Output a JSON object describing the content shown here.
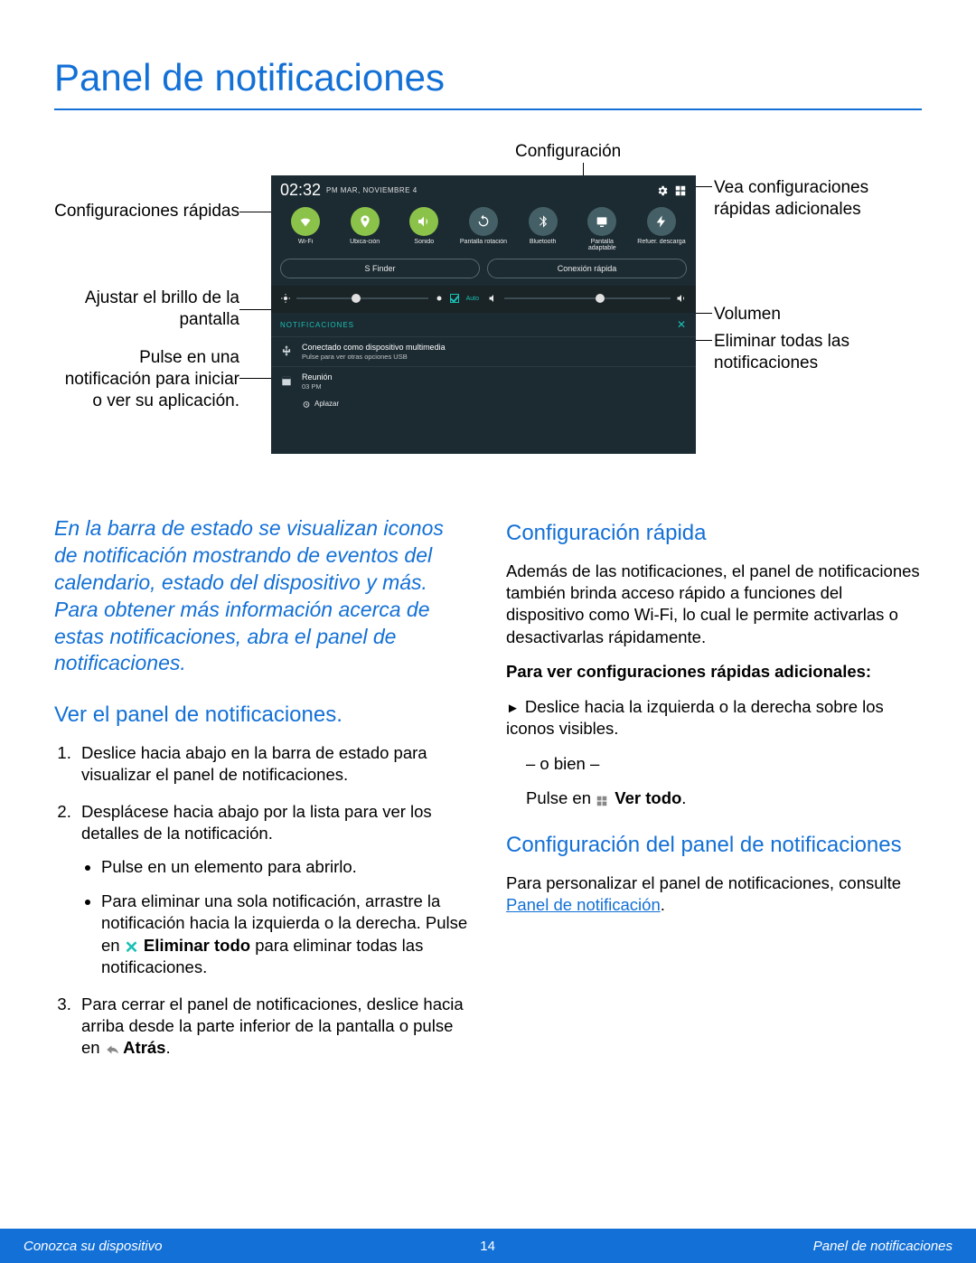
{
  "title": "Panel de notificaciones",
  "callouts": {
    "settings": "Configuración",
    "quick_more": "Vea configuraciones rápidas adicionales",
    "quick": "Configuraciones rápidas",
    "brightness": "Ajustar el brillo de la pantalla",
    "tap_notif": "Pulse en una notificación para iniciar o ver su aplicación.",
    "volume": "Volumen",
    "clear_all": "Eliminar todas las notificaciones"
  },
  "panel": {
    "clock": "02:32",
    "ampm_date": "PM  MAR, NOVIEMBRE 4",
    "quick": [
      {
        "label": "Wi-Fi",
        "on": true
      },
      {
        "label": "Ubica-ción",
        "on": true
      },
      {
        "label": "Sonido",
        "on": true
      },
      {
        "label": "Pantalla rotación",
        "on": false
      },
      {
        "label": "Bluetooth",
        "on": false
      },
      {
        "label": "Pantalla adaptable",
        "on": false
      },
      {
        "label": "Refuer. descarga",
        "on": false
      }
    ],
    "pill_sfinder": "S Finder",
    "pill_quick": "Conexión rápida",
    "auto": "Auto",
    "notif_header": "NOTIFICACIONES",
    "notif1_title": "Conectado como dispositivo multimedia",
    "notif1_sub": "Pulse para ver otras opciones USB",
    "notif2_title": "Reunión",
    "notif2_sub": "03 PM",
    "snooze": "Aplazar"
  },
  "intro": "En la barra de estado se visualizan iconos de notificación mostrando de eventos del calendario, estado del dispositivo y más. Para obtener más información acerca de estas notificaciones, abra el panel de notificaciones.",
  "left": {
    "h": "Ver el panel de notificaciones.",
    "ol1": "Deslice hacia abajo en la barra de estado para visualizar el panel de notificaciones.",
    "ol2": "Desplácese hacia abajo por la lista para ver los detalles de la notificación.",
    "ul1": "Pulse en un elemento para abrirlo.",
    "ul2a": "Para eliminar una sola notificación, arrastre la notificación hacia la izquierda o la derecha. Pulse en ",
    "ul2b": " Eliminar todo",
    "ul2c": " para eliminar todas las notificaciones.",
    "ol3a": "Para cerrar el panel de notificaciones, deslice hacia arriba desde la parte inferior de la pantalla o pulse en ",
    "ol3b": " Atrás",
    "ol3c": "."
  },
  "right": {
    "h1": "Configuración rápida",
    "p1": "Además de las notificaciones, el panel de notificaciones también brinda acceso rápido a funciones del dispositivo como Wi-Fi, lo cual le permite activarlas o desactivarlas rápidamente.",
    "bold1": "Para ver configuraciones rápidas adicionales:",
    "li1": "Deslice hacia la izquierda o la derecha sobre los iconos visibles.",
    "or": "– o bien –",
    "li2a": "Pulse en ",
    "li2b": " Ver todo",
    "li2c": ".",
    "h2": "Configuración del panel de notificaciones",
    "p2a": "Para personalizar el panel de notificaciones, consulte ",
    "p2b": "Panel de notificación",
    "p2c": "."
  },
  "footer": {
    "left": "Conozca su dispositivo",
    "page": "14",
    "right": "Panel de notificaciones"
  }
}
